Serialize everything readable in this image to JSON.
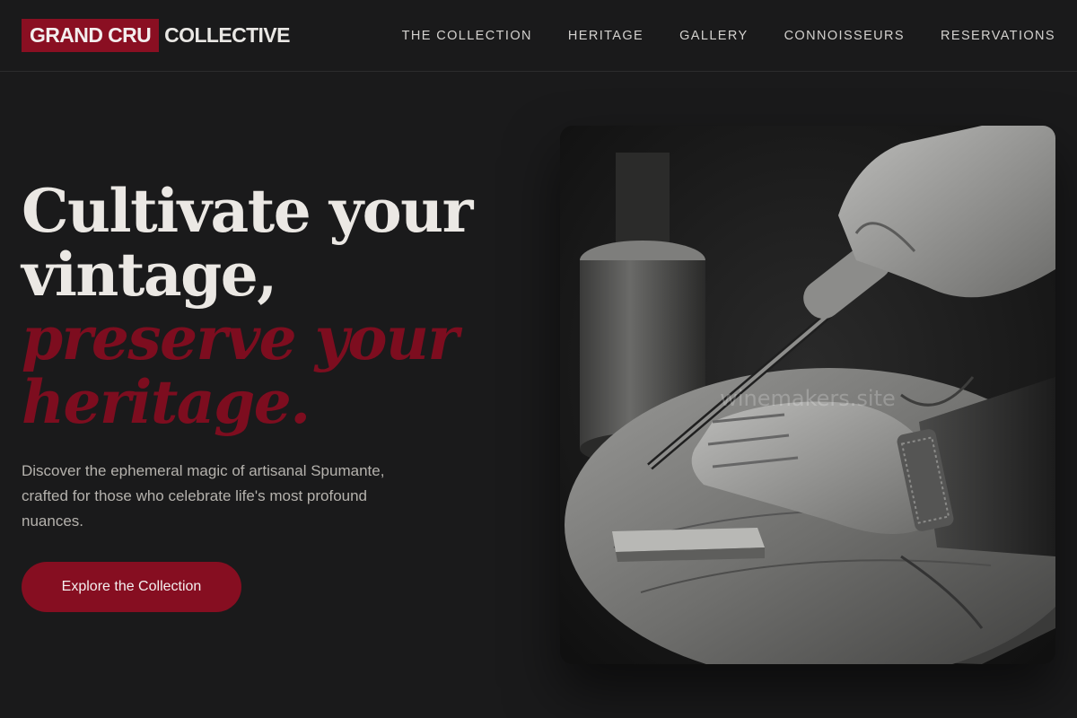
{
  "brand": {
    "mark": "GRAND CRU",
    "name": "COLLECTIVE",
    "accent_color": "#8a0f22"
  },
  "nav": {
    "items": [
      {
        "label": "THE COLLECTION"
      },
      {
        "label": "HERITAGE"
      },
      {
        "label": "GALLERY"
      },
      {
        "label": "CONNOISSEURS"
      },
      {
        "label": "RESERVATIONS"
      }
    ]
  },
  "hero": {
    "title_line1": "Cultivate your",
    "title_line2": "vintage,",
    "title_accent_line1": "preserve your",
    "title_accent_line2": "heritage.",
    "subtitle": "Discover the ephemeral magic of artisanal Spumante, crafted for those who celebrate life's most profound nuances.",
    "cta_label": "Explore the Collection"
  },
  "image": {
    "alt": "Black and white photo of hands carving wood with a chisel on a tree stump",
    "watermark": "winemakers.site"
  }
}
